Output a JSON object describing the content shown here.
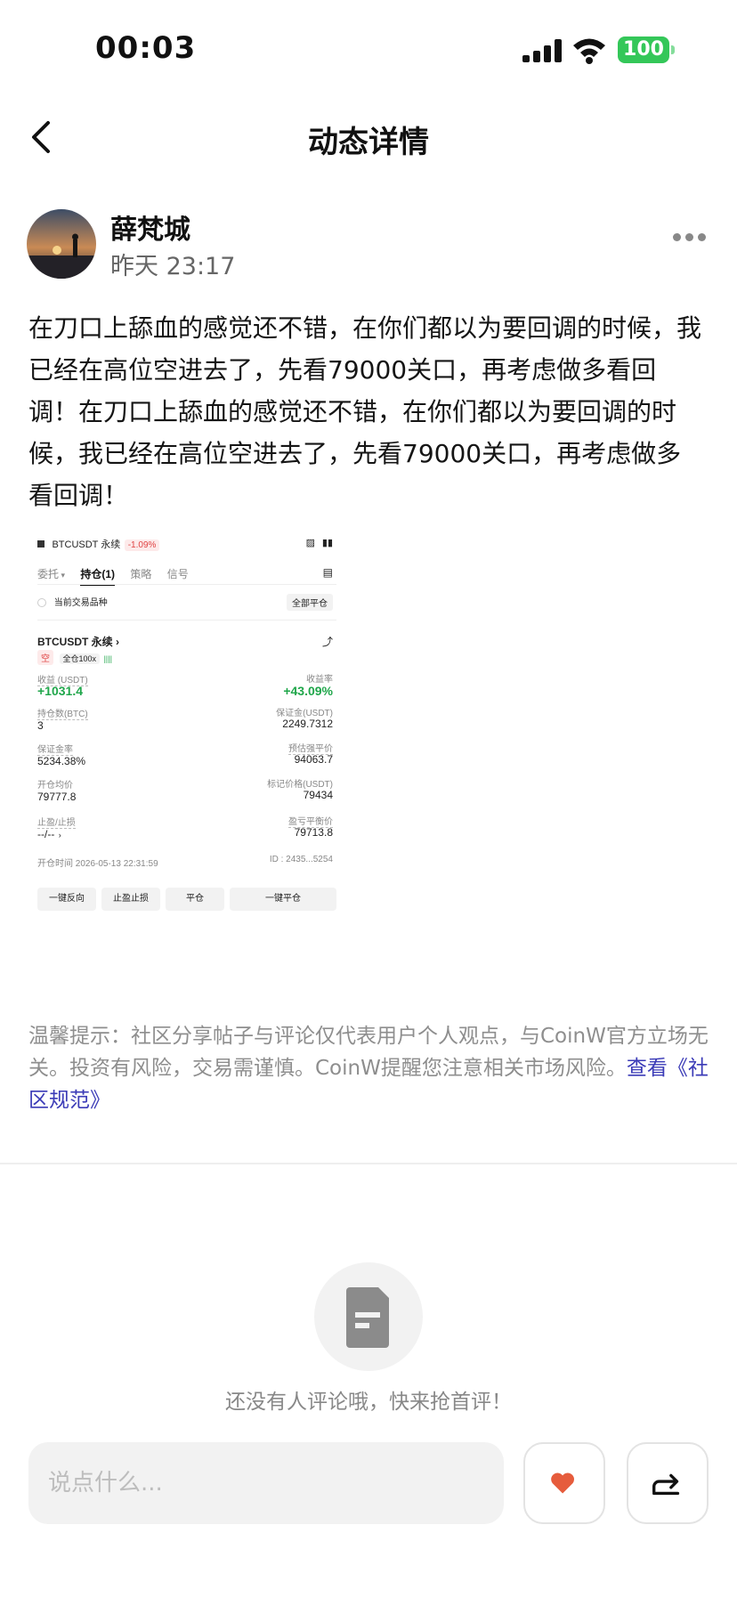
{
  "status": {
    "time": "00:03",
    "battery": "100"
  },
  "nav": {
    "title": "动态详情"
  },
  "post": {
    "author": "薛梵城",
    "time": "昨天 23:17",
    "text": "在刀口上舔血的感觉还不错，在你们都以为要回调的时候，我已经在高位空进去了，先看79000关口，再考虑做多看回调！在刀口上舔血的感觉还不错，在你们都以为要回调的时候，我已经在高位空进去了，先看79000关口，再考虑做多看回调！"
  },
  "trade_card": {
    "symbol_header": "BTCUSDT 永续",
    "change": "-1.09%",
    "tabs": [
      "委托",
      "持仓(1)",
      "策略",
      "信号"
    ],
    "filter_label": "当前交易品种",
    "close_all": "全部平仓",
    "position_symbol": "BTCUSDT 永续",
    "side": "空",
    "margin_mode": "全仓100x",
    "pnl_label": "收益 (USDT)",
    "pnl_value": "+1031.4",
    "roe_label": "收益率",
    "roe_value": "+43.09%",
    "size_label": "持仓数(BTC)",
    "size_value": "3",
    "margin_label": "保证金(USDT)",
    "margin_value": "2249.7312",
    "margin_ratio_label": "保证金率",
    "margin_ratio_value": "5234.38%",
    "liq_label": "预估强平价",
    "liq_value": "94063.7",
    "entry_label": "开仓均价",
    "entry_value": "79777.8",
    "mark_label": "标记价格(USDT)",
    "mark_value": "79434",
    "tpsl_label": "止盈/止损",
    "tpsl_value": "--/--",
    "breakeven_label": "盈亏平衡价",
    "breakeven_value": "79713.8",
    "open_time": "开仓时间 2026-05-13 22:31:59",
    "id": "ID : 2435...5254",
    "buttons": [
      "一键反向",
      "止盈止损",
      "平仓",
      "一键平仓"
    ]
  },
  "notice": {
    "text": "温馨提示：社区分享帖子与评论仅代表用户个人观点，与CoinW官方立场无关。投资有风险，交易需谨慎。CoinW提醒您注意相关市场风险。",
    "link": "查看《社区规范》"
  },
  "comments": {
    "empty_text": "还没有人评论哦，快来抢首评！"
  },
  "input": {
    "placeholder": "说点什么..."
  },
  "colors": {
    "green": "#1fa64a",
    "red": "#e04444",
    "link": "#3b3bb7",
    "heart": "#e65c3c"
  }
}
